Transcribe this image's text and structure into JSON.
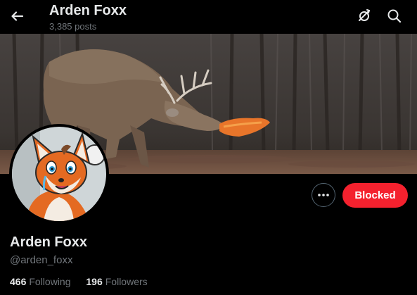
{
  "header": {
    "title": "Arden Foxx",
    "posts_count": "3,385 posts",
    "back_icon": "arrow-left-icon",
    "right_icons": [
      "no-notifications-icon",
      "search-icon"
    ]
  },
  "profile": {
    "display_name": "Arden Foxx",
    "handle": "@arden_foxx",
    "following_count": "466",
    "following_label": "Following",
    "followers_count": "196",
    "followers_label": "Followers",
    "blocked_label": "Blocked",
    "more_icon": "more-horizontal-icon"
  },
  "colors": {
    "background": "#000000",
    "primary_text": "#e7e9ea",
    "secondary_text": "#71767b",
    "blocked_button": "#f4212e"
  }
}
